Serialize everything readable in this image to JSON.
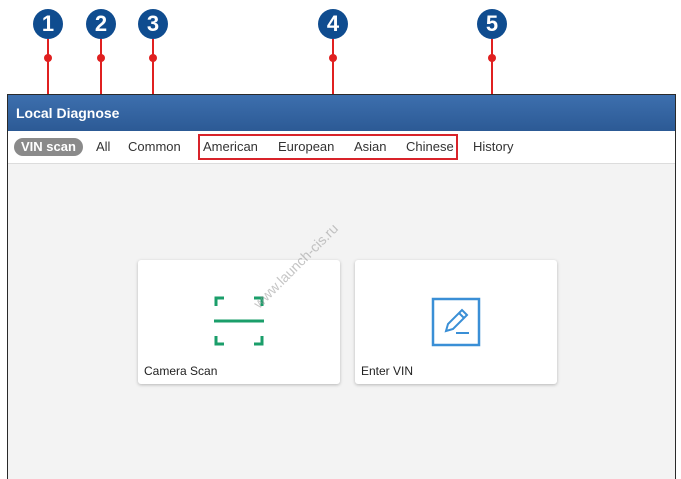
{
  "callouts": [
    "1",
    "2",
    "3",
    "4",
    "5"
  ],
  "header": {
    "title": "Local Diagnose"
  },
  "tabs": {
    "vin_scan": "VIN scan",
    "all": "All",
    "common": "Common",
    "american": "American",
    "european": "European",
    "asian": "Asian",
    "chinese": "Chinese",
    "history": "History"
  },
  "cards": {
    "camera_scan": "Camera Scan",
    "enter_vin": "Enter VIN"
  },
  "watermark": "www.launch-cis.ru",
  "colors": {
    "title_bar": "#2c5a95",
    "callout_bubble": "#0f4c8f",
    "callout_line": "#e02020",
    "active_tab": "#8a8a8a",
    "icon_green": "#1a9e6a",
    "icon_blue": "#3a8fd6"
  },
  "icons": [
    "scan-frame-icon",
    "edit-document-icon"
  ]
}
